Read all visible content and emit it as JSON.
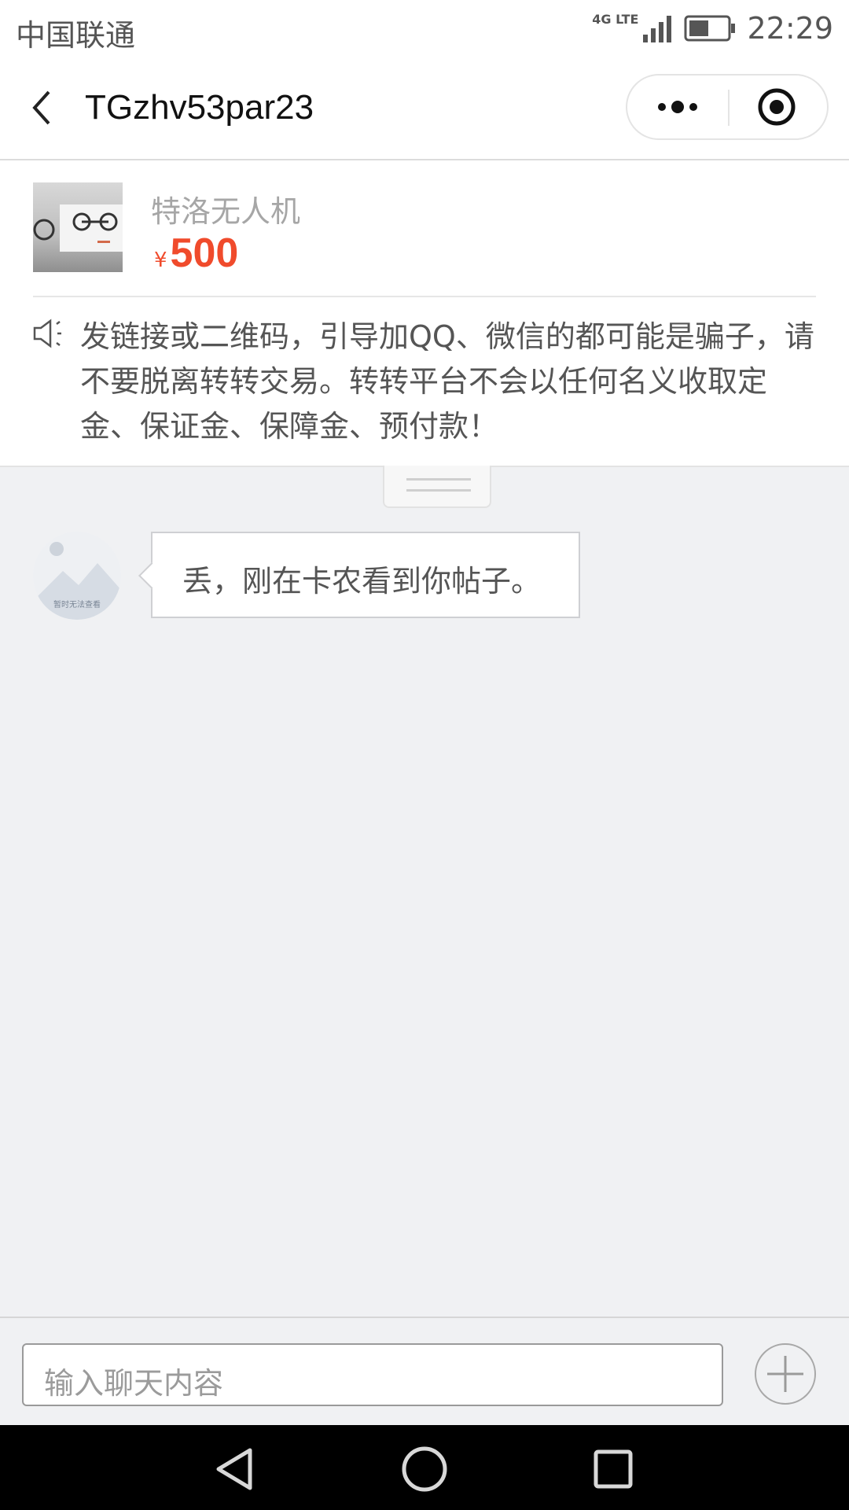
{
  "status_bar": {
    "carrier": "中国联通",
    "network": "4G LTE",
    "time": "22:29",
    "icons": [
      "signal-icon",
      "battery-icon"
    ]
  },
  "nav": {
    "title": "TGzhv53par23",
    "icons": [
      "back-arrow-icon",
      "more-dots-icon",
      "close-target-icon"
    ]
  },
  "product": {
    "name": "特洛无人机",
    "currency": "¥",
    "price": "500"
  },
  "notice": {
    "icon": "speaker-icon",
    "text": "发链接或二维码，引导加QQ、微信的都可能是骗子，请不要脱离转转交易。转转平台不会以任何名义收取定金、保证金、保障金、预付款！"
  },
  "messages": [
    {
      "avatar_caption": "暂时无法查看",
      "text": "丢，刚在卡农看到你帖子。"
    }
  ],
  "composer": {
    "placeholder": "输入聊天内容",
    "icons": [
      "plus-icon"
    ]
  },
  "colors": {
    "price": "#f04b2c",
    "background": "#f0f1f3",
    "nav_bar": "#000000"
  }
}
